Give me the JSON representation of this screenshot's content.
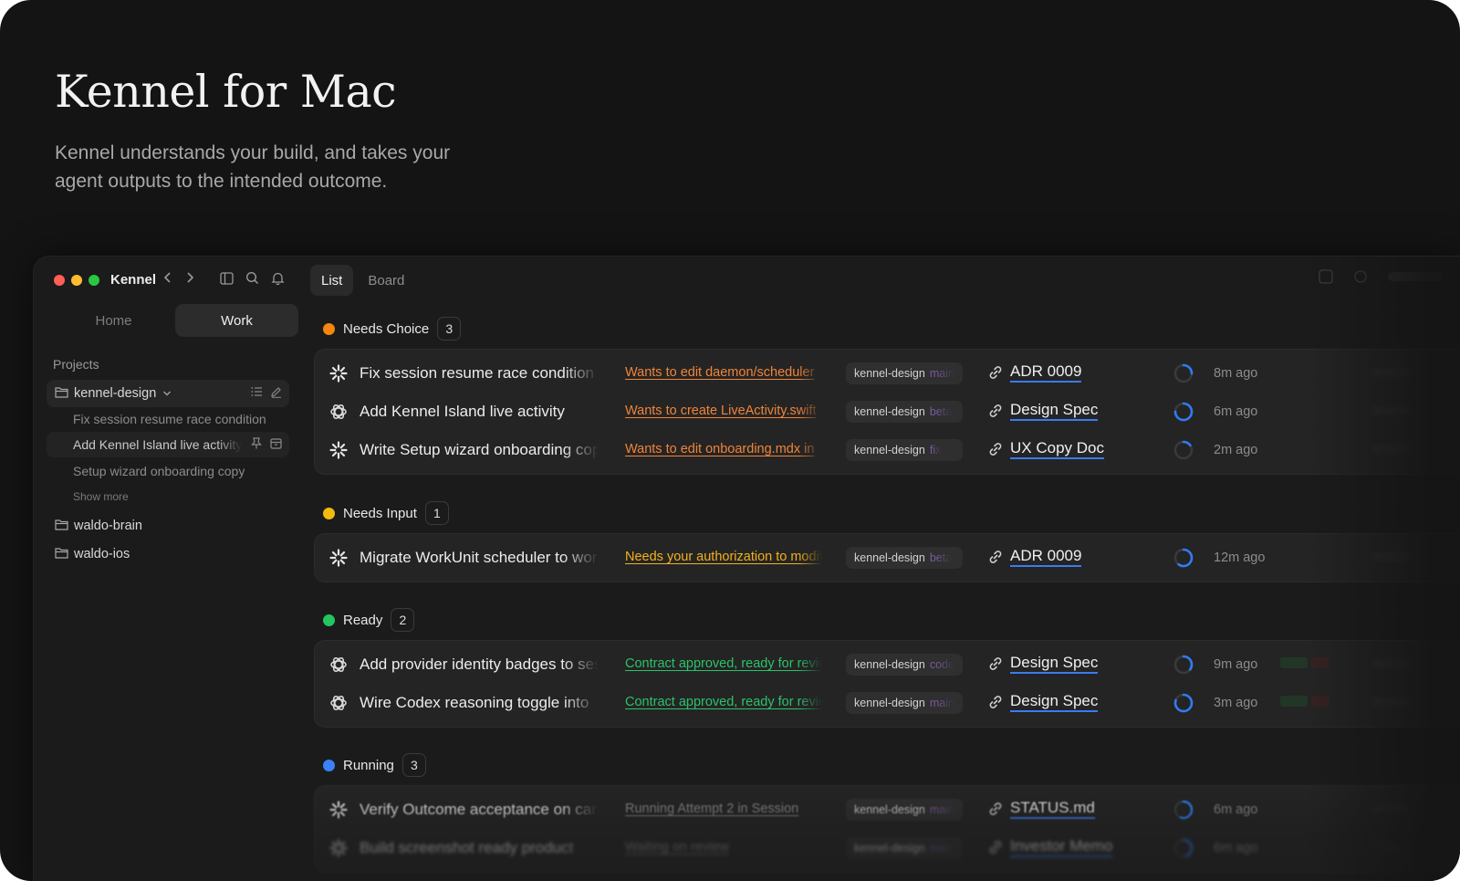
{
  "hero": {
    "title": "Kennel for Mac",
    "subtitle": "Kennel understands your build, and takes your agent outputs to the intended outcome."
  },
  "window": {
    "app_name": "Kennel",
    "traffic_colors": [
      "#ff5f57",
      "#febc2e",
      "#28c840"
    ]
  },
  "sidebar": {
    "segments": [
      {
        "label": "Home",
        "active": false
      },
      {
        "label": "Work",
        "active": true
      }
    ],
    "projects_label": "Projects",
    "projects": [
      {
        "name": "kennel-design",
        "expanded": true
      },
      {
        "name": "waldo-brain",
        "expanded": false
      },
      {
        "name": "waldo-ios",
        "expanded": false
      }
    ],
    "tasks": [
      "Fix session resume race condition",
      "Add Kennel Island live activity",
      "Setup wizard onboarding copy"
    ],
    "show_more": "Show more"
  },
  "main": {
    "tabs": [
      {
        "label": "List",
        "active": true
      },
      {
        "label": "Board",
        "active": false
      }
    ],
    "groups": [
      {
        "label": "Needs Choice",
        "count": "3",
        "color": "#f5860f",
        "rows": [
          {
            "icon": "asterisk-icon",
            "title": "Fix session resume race condition",
            "status": "Wants to edit daemon/scheduler",
            "status_color": "#f0843a",
            "branch": "kennel-design",
            "branch_tail": "main",
            "link": "ADR 0009",
            "time": "8m ago"
          },
          {
            "icon": "openai-icon",
            "title": "Add Kennel Island live activity",
            "status": "Wants to create LiveActivity.swift",
            "status_color": "#f0843a",
            "branch": "kennel-design",
            "branch_tail": "beta",
            "link": "Design Spec",
            "time": "6m ago"
          },
          {
            "icon": "asterisk-icon",
            "title": "Write Setup wizard onboarding copy",
            "status": "Wants to edit onboarding.mdx in",
            "status_color": "#f0843a",
            "branch": "kennel-design",
            "branch_tail": "fix",
            "link": "UX Copy Doc",
            "time": "2m ago"
          }
        ]
      },
      {
        "label": "Needs Input",
        "count": "1",
        "color": "#f2b90e",
        "rows": [
          {
            "icon": "asterisk-icon",
            "title": "Migrate WorkUnit scheduler to work",
            "status": "Needs your authorization to modify",
            "status_color": "#f2b21c",
            "branch": "kennel-design",
            "branch_tail": "beta",
            "link": "ADR 0009",
            "time": "12m ago"
          }
        ]
      },
      {
        "label": "Ready",
        "count": "2",
        "color": "#22c55e",
        "rows": [
          {
            "icon": "openai-icon",
            "title": "Add provider identity badges to sessions",
            "status": "Contract approved, ready for review",
            "status_color": "#2bc26a",
            "branch": "kennel-design",
            "branch_tail": "code",
            "link": "Design Spec",
            "time": "9m ago"
          },
          {
            "icon": "openai-icon",
            "title": "Wire Codex reasoning toggle into",
            "status": "Contract approved, ready for review",
            "status_color": "#2bc26a",
            "branch": "kennel-design",
            "branch_tail": "main",
            "link": "Design Spec",
            "time": "3m ago"
          }
        ]
      },
      {
        "label": "Running",
        "count": "3",
        "color": "#3b82f6",
        "rows": [
          {
            "icon": "asterisk-icon",
            "title": "Verify Outcome acceptance on card",
            "status": "Running Attempt 2 in Session",
            "status_color": "#8a8a8a",
            "branch": "kennel-design",
            "branch_tail": "main",
            "link": "STATUS.md",
            "time": "6m ago"
          },
          {
            "icon": "asterisk-icon",
            "title": "Build screenshot ready product",
            "status": "Waiting on review",
            "status_color": "#8a8a8a",
            "branch": "kennel-design",
            "branch_tail": "main",
            "link": "Investor Memo",
            "time": "6m ago"
          }
        ]
      }
    ]
  }
}
